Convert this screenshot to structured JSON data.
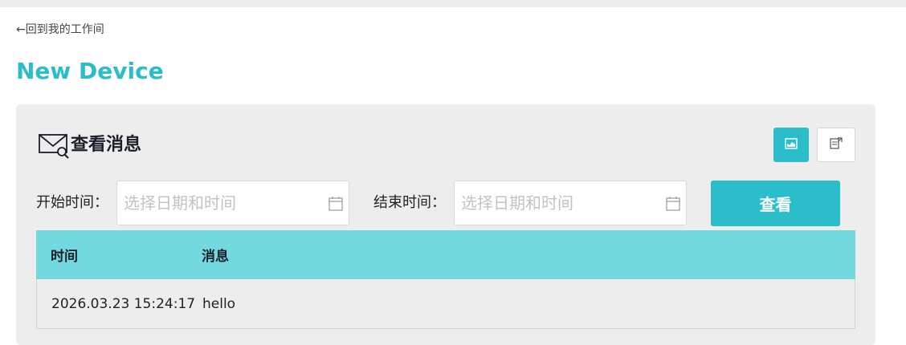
{
  "nav": {
    "back_label": "←回到我的工作间"
  },
  "page": {
    "title": "New Device"
  },
  "panel": {
    "title": "查看消息",
    "chart_button_icon": "chart-icon",
    "export_button_icon": "export-icon"
  },
  "filters": {
    "start_label": "开始时间：",
    "start_placeholder": "选择日期和时间",
    "end_label": "结束时间：",
    "end_placeholder": "选择日期和时间",
    "search_button": "查看"
  },
  "table": {
    "headers": [
      "时间",
      "消息"
    ],
    "rows": [
      {
        "time": "2026.03.23 15:24:17",
        "message": "hello"
      }
    ]
  },
  "colors": {
    "accent": "#2bbdca",
    "header_row": "#73d9df",
    "panel_bg": "#ededed"
  }
}
